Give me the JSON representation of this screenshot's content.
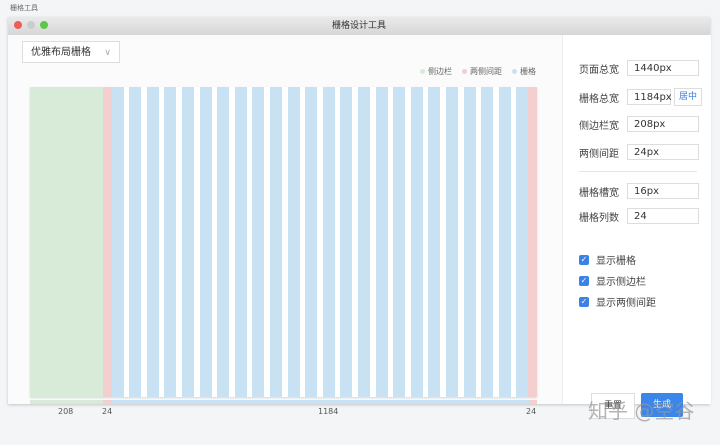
{
  "app_title": "栅格工具",
  "window": {
    "title": "栅格设计工具"
  },
  "preset": {
    "selected": "优雅布局栅格"
  },
  "legend": [
    {
      "label": "侧边栏",
      "color": "#d8ebd9"
    },
    {
      "label": "两侧间距",
      "color": "#f3cfcf"
    },
    {
      "label": "栅格",
      "color": "#c8e1f3"
    }
  ],
  "grid": {
    "sidebar_width": 208,
    "margin": 24,
    "grid_width": 1184,
    "gutter": 16,
    "columns": 24
  },
  "labels": {
    "sidebar": "208",
    "margin_left": "24",
    "grid": "1184",
    "margin_right": "24"
  },
  "settings": {
    "page_width": {
      "label": "页面总宽",
      "value": "1440px"
    },
    "grid_width": {
      "label": "栅格总宽",
      "value": "1184px",
      "button": "居中"
    },
    "sidebar_width": {
      "label": "侧边栏宽",
      "value": "208px"
    },
    "margin": {
      "label": "两侧间距",
      "value": "24px"
    },
    "gutter": {
      "label": "栅格槽宽",
      "value": "16px"
    },
    "columns": {
      "label": "栅格列数",
      "value": "24"
    }
  },
  "checkboxes": [
    {
      "label": "显示栅格",
      "checked": true
    },
    {
      "label": "显示侧边栏",
      "checked": true
    },
    {
      "label": "显示两侧间距",
      "checked": true
    }
  ],
  "buttons": {
    "reset": "重置",
    "generate": "生成"
  },
  "watermark": "知乎 @空谷"
}
